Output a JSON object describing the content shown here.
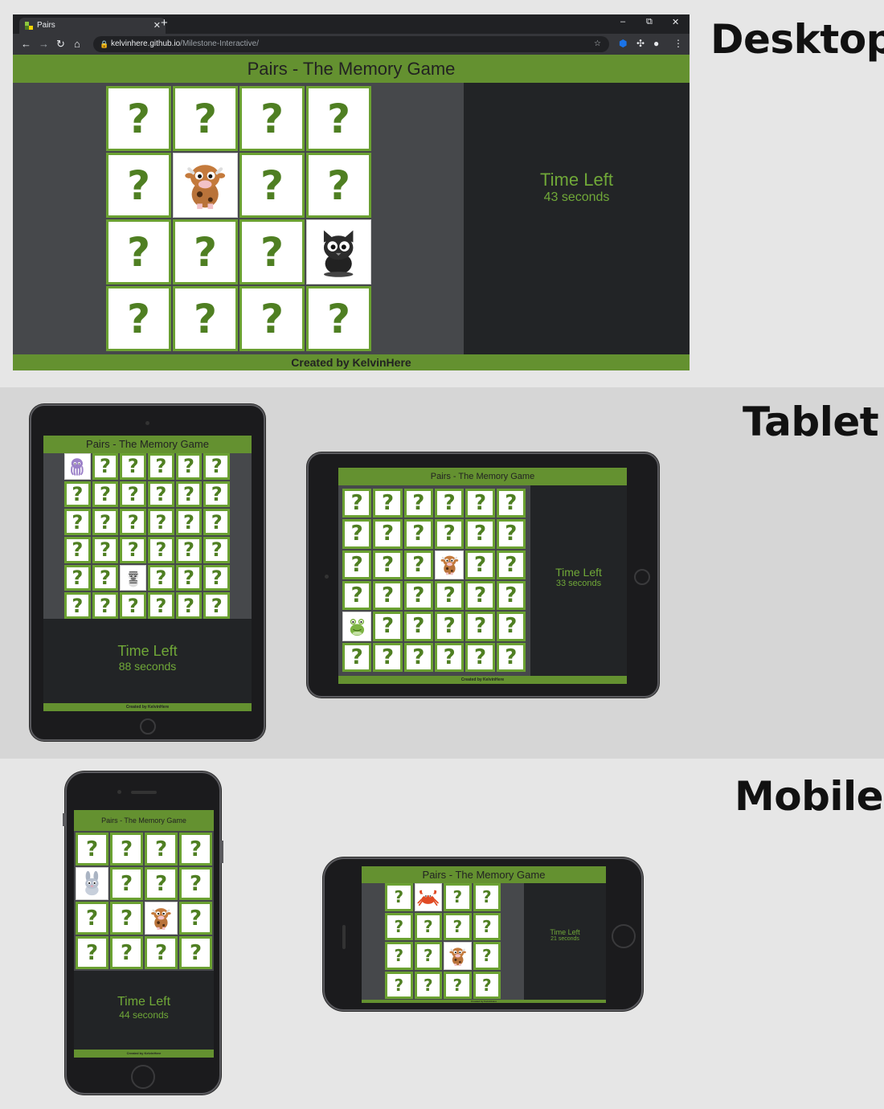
{
  "sections": {
    "desktop": "Desktop",
    "tablet": "Tablet",
    "mobile": "Mobile"
  },
  "browser": {
    "tab_title": "Pairs",
    "tab_close": "✕",
    "new_tab": "+",
    "url_host": "kelvinhere.github.io",
    "url_path": "/Milestone-Interactive/",
    "minimize": "–",
    "restore": "⧉",
    "close": "✕"
  },
  "game": {
    "title": "Pairs - The Memory Game",
    "time_label": "Time Left",
    "footer": "Created by KelvinHere",
    "hidden_symbol": "?"
  },
  "views": {
    "desktop": {
      "cols": 4,
      "rows": 4,
      "seconds": "43 seconds",
      "revealed": [
        [
          1,
          1,
          "cow"
        ],
        [
          2,
          3,
          "cat"
        ]
      ]
    },
    "tablet_portrait": {
      "cols": 6,
      "rows": 6,
      "seconds": "88 seconds",
      "revealed": [
        [
          0,
          0,
          "octopus"
        ],
        [
          4,
          2,
          "zebra"
        ]
      ]
    },
    "tablet_landscape": {
      "cols": 6,
      "rows": 6,
      "seconds": "33 seconds",
      "revealed": [
        [
          2,
          3,
          "cow"
        ],
        [
          4,
          0,
          "frog"
        ]
      ]
    },
    "mobile_portrait": {
      "cols": 4,
      "rows": 4,
      "seconds": "44 seconds",
      "revealed": [
        [
          1,
          0,
          "rabbit"
        ],
        [
          2,
          2,
          "cow"
        ]
      ]
    },
    "mobile_landscape": {
      "cols": 4,
      "rows": 4,
      "seconds": "21 seconds",
      "revealed": [
        [
          0,
          1,
          "crab"
        ],
        [
          2,
          2,
          "cow"
        ]
      ]
    }
  },
  "colors": {
    "accent_green": "#649130",
    "card_border": "#6ba132",
    "question_mark": "#4f7f22",
    "timer_text": "#70a838",
    "board_bg": "#46484b",
    "panel_bg": "#222426"
  }
}
